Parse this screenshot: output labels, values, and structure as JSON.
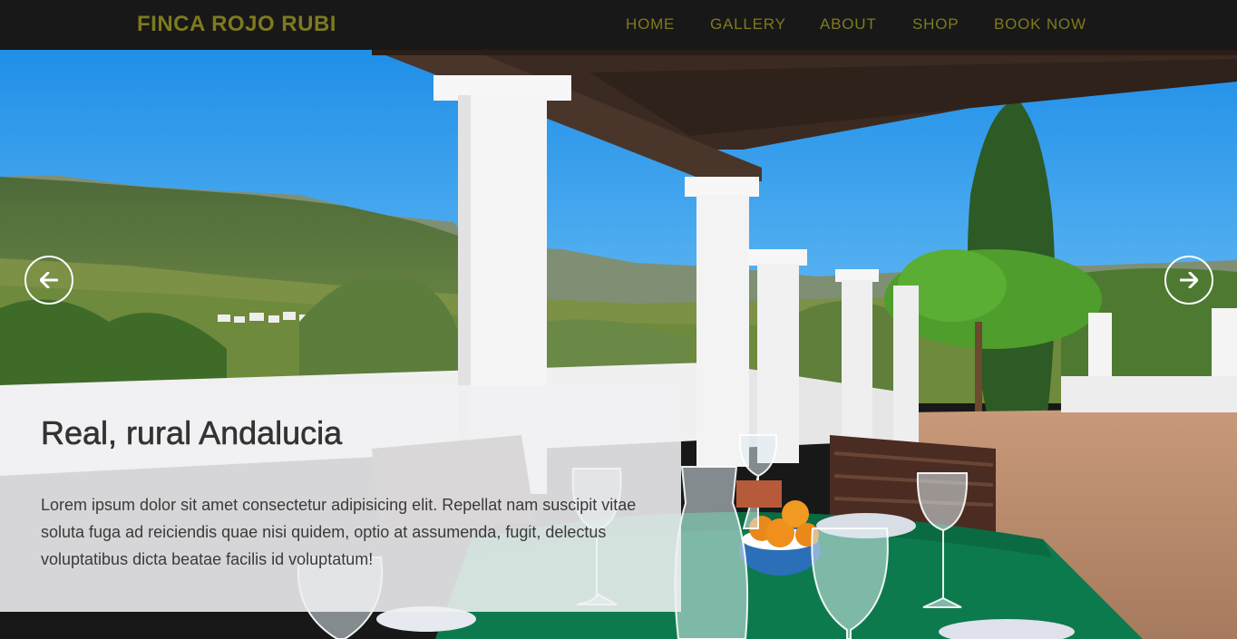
{
  "brand": {
    "name": "FINCA ROJO RUBI"
  },
  "nav": {
    "items": [
      {
        "label": "HOME"
      },
      {
        "label": "GALLERY"
      },
      {
        "label": "ABOUT"
      },
      {
        "label": "SHOP"
      },
      {
        "label": "BOOK NOW"
      }
    ]
  },
  "carousel": {
    "prev_icon": "arrow-left-icon",
    "next_icon": "arrow-right-icon",
    "slide": {
      "image_alt": "terrace-view-image",
      "title": "Real, rural Andalucia",
      "text": "Lorem ipsum dolor sit amet consectetur adipisicing elit. Repellat nam suscipit vitae soluta fuga ad reiciendis quae nisi quidem, optio at assumenda, fugit, delectus voluptatibus dicta beatae facilis id voluptatum!"
    }
  },
  "colors": {
    "nav_bg": "#181818",
    "nav_text": "#7e7a1f",
    "caption_bg": "#f0f0f2"
  }
}
